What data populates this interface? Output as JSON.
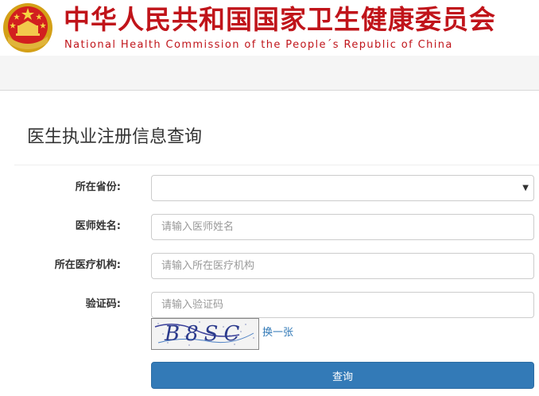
{
  "header": {
    "org_name_cn": "中华人民共和国国家卫生健康委员会",
    "org_name_en": "National Health Commission of the People´s Republic of China",
    "emblem_icon": "national-emblem-icon"
  },
  "colors": {
    "brand_red": "#c0141a",
    "primary_blue": "#337ab7",
    "link_blue": "#337ab7"
  },
  "form": {
    "title": "医生执业注册信息查询",
    "province": {
      "label": "所在省份:",
      "value": ""
    },
    "doctor_name": {
      "label": "医师姓名:",
      "placeholder": "请输入医师姓名"
    },
    "institution": {
      "label": "所在医疗机构:",
      "placeholder": "请输入所在医疗机构"
    },
    "captcha": {
      "label": "验证码:",
      "placeholder": "请输入验证码",
      "refresh_label": "换一张",
      "image_text": "B8SC"
    },
    "submit_label": "查询"
  }
}
